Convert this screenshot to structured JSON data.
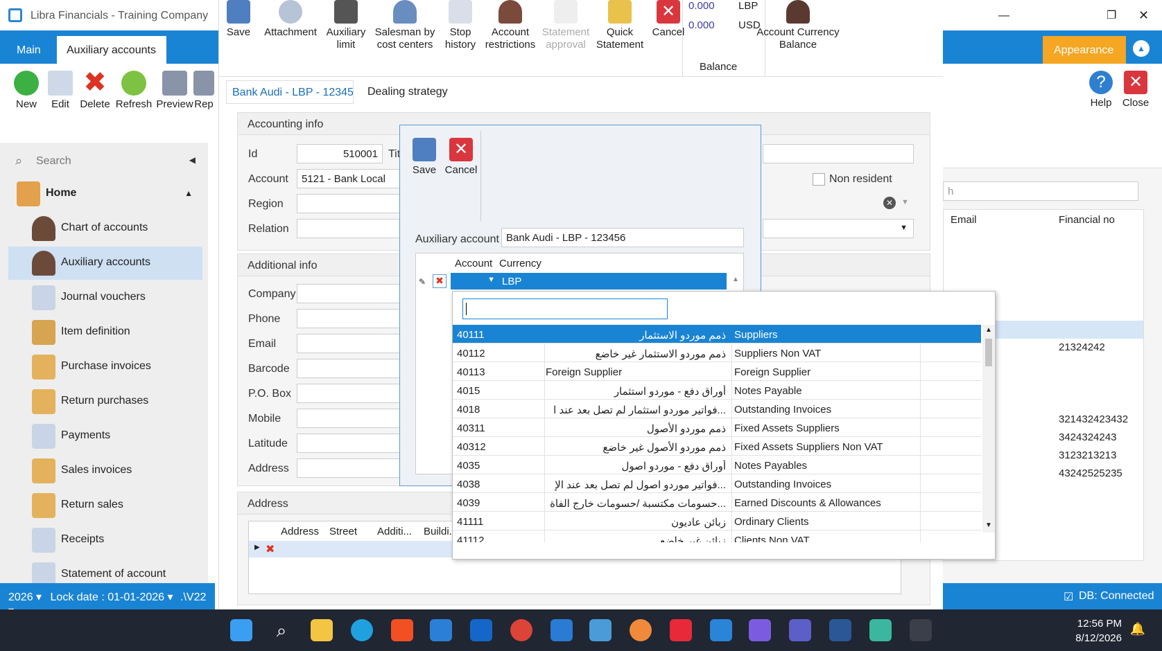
{
  "window": {
    "title": "Libra Financials - Training Company"
  },
  "ribbon_tabs": [
    "Main",
    "Auxiliary accounts"
  ],
  "left_toolbar": [
    "New",
    "Edit",
    "Delete",
    "Refresh",
    "Preview",
    "Rep"
  ],
  "search_placeholder": "Search",
  "nav": {
    "home": "Home",
    "items": [
      "Chart of accounts",
      "Auxiliary accounts",
      "Journal vouchers",
      "Item definition",
      "Purchase invoices",
      "Return purchases",
      "Payments",
      "Sales invoices",
      "Return sales",
      "Receipts",
      "Statement of account"
    ]
  },
  "statusbar": {
    "year": "2026",
    "lock": "Lock date : 01-01-2026",
    "version": ".\\V22"
  },
  "toolbar": {
    "save": "Save",
    "attachment": "Attachment",
    "aux_limit": "Auxiliary limit",
    "salesman": "Salesman by cost centers",
    "stop_history": "Stop history",
    "acct_restrictions": "Account restrictions",
    "stmt_approval": "Statement approval",
    "quick_stmt": "Quick Statement",
    "cancel": "Cancel",
    "bal_lbp": "0.000",
    "cur_lbp": "LBP",
    "bal_usd": "0.000",
    "cur_usd": "USD",
    "balance": "Balance",
    "acct_cur_balance": "Account Currency Balance"
  },
  "doc_tabs": [
    "Bank Audi - LBP - 12345",
    "Dealing strategy"
  ],
  "form": {
    "accounting_info": "Accounting info",
    "id_label": "Id",
    "id_value": "510001",
    "title_label": "Tit",
    "account_label": "Account",
    "account_value": "5121 - Bank Local",
    "region_label": "Region",
    "relation_label": "Relation",
    "non_resident": "Non resident",
    "additional_info": "Additional info",
    "fields": [
      "Company",
      "Phone",
      "Email",
      "Barcode",
      "P.O. Box",
      "Mobile",
      "Latitude",
      "Address"
    ],
    "address_section": "Address",
    "address_cols": [
      "Address",
      "Street",
      "Additi...",
      "Buildi..."
    ]
  },
  "right": {
    "appearance": "Appearance",
    "help": "Help",
    "close": "Close",
    "search_partial": "h",
    "col_email": "Email",
    "col_financial": "Financial no",
    "financial_values": [
      "21324242",
      "321432423432",
      "3424324243",
      "3123213213",
      "43242525235"
    ],
    "db_status": "DB: Connected"
  },
  "dialog": {
    "save": "Save",
    "cancel": "Cancel",
    "aux_label": "Auxiliary account",
    "aux_value": "Bank Audi - LBP - 123456",
    "col_account": "Account",
    "col_currency": "Currency",
    "currency_value": "LBP"
  },
  "dropdown": {
    "rows": [
      [
        "40111",
        "ذمم موردو الاستثمار",
        "Suppliers"
      ],
      [
        "40112",
        "ذمم موردو الاستثمار غير خاضع",
        "Suppliers Non VAT"
      ],
      [
        "40113",
        "Foreign Supplier",
        "Foreign Supplier"
      ],
      [
        "4015",
        "أوراق دفع - موردو استثمار",
        "Notes Payable"
      ],
      [
        "4018",
        "...فواتير موردو استثمار لم تصل بعد عند ا",
        "Outstanding Invoices"
      ],
      [
        "40311",
        "ذمم موردو الأصول",
        "Fixed Assets Suppliers"
      ],
      [
        "40312",
        "ذمم موردو الأصول غير خاضع",
        "Fixed Assets Suppliers Non VAT"
      ],
      [
        "4035",
        "أوراق دفع - موردو اصول",
        "Notes Payables"
      ],
      [
        "4038",
        "...فواتير موردو اصول لم تصل بعد عند الإ",
        "Outstanding Invoices"
      ],
      [
        "4039",
        "...حسومات مكتسبة /حسومات خارج الفاة",
        "Earned Discounts & Allowances"
      ],
      [
        "41111",
        "زبائن عاديون",
        "Ordinary Clients"
      ],
      [
        "41112",
        "زبائن غير خاضع",
        "Clients Non VAT"
      ]
    ]
  },
  "taskbar": {
    "time": "12:56 PM",
    "date": "8/12/2026"
  }
}
